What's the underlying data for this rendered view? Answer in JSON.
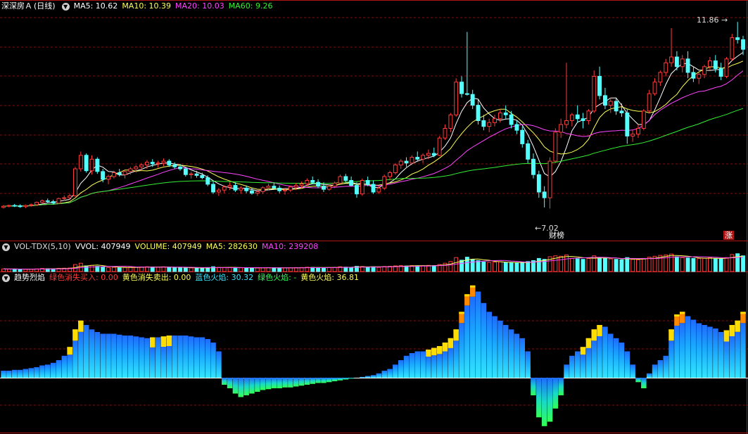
{
  "colors": {
    "up": "#ff3b3b",
    "down": "#54ffff",
    "ma5": "#ffffff",
    "ma10": "#ffff55",
    "ma20": "#ff44ff",
    "ma60": "#33ee33",
    "grid": "#7a1010",
    "border": "#b01515",
    "blue": "#1f6bff",
    "cyan": "#33e6ff",
    "green": "#33ff55",
    "yellow": "#ffdd00",
    "orange": "#ff8800",
    "red": "#ff2200"
  },
  "main_header": {
    "stock_name": "深深房Ａ",
    "period": "(日线)",
    "ma5": "MA5: 10.62",
    "ma10": "MA10: 10.39",
    "ma20": "MA20: 10.03",
    "ma60": "MA60: 9.26"
  },
  "volume_header": {
    "indicator": "VOL-TDX(5,10)",
    "vvol": "VVOL: 407949",
    "volume": "VOLUME: 407949",
    "ma5": "MA5: 282630",
    "ma10": "MA10: 239208"
  },
  "flame_header": {
    "indicator": "趋势烈焰",
    "green_buy": "绿色消失买入: 0.00",
    "yellow_sell": "黄色消失卖出: 0.00",
    "blue_flame": "蓝色火焰: 30.32",
    "green_flame": "绿色火焰: -",
    "yellow_flame": "黄色火焰: 36.81"
  },
  "annotations": {
    "high_price": "11.86",
    "low_price": "7.02",
    "report_tag": "财",
    "report_tag2": "榜",
    "rise_tag": "涨"
  },
  "chart_data": {
    "type": "candlestick",
    "price_range": [
      6.5,
      12.1
    ],
    "ohlc": [
      [
        7.05,
        7.11,
        7.02,
        7.08
      ],
      [
        7.08,
        7.12,
        7.05,
        7.1
      ],
      [
        7.1,
        7.14,
        7.06,
        7.09
      ],
      [
        7.09,
        7.13,
        7.04,
        7.07
      ],
      [
        7.07,
        7.12,
        7.03,
        7.1
      ],
      [
        7.1,
        7.15,
        7.07,
        7.12
      ],
      [
        7.12,
        7.2,
        7.09,
        7.18
      ],
      [
        7.18,
        7.26,
        7.14,
        7.22
      ],
      [
        7.22,
        7.28,
        7.16,
        7.2
      ],
      [
        7.2,
        7.25,
        7.12,
        7.16
      ],
      [
        7.16,
        7.3,
        7.14,
        7.28
      ],
      [
        7.28,
        7.36,
        7.22,
        7.3
      ],
      [
        7.3,
        7.4,
        7.25,
        7.35
      ],
      [
        7.35,
        8.1,
        7.33,
        8.05
      ],
      [
        8.05,
        8.5,
        7.98,
        8.4
      ],
      [
        8.4,
        8.45,
        7.95,
        8.0
      ],
      [
        8.0,
        8.4,
        7.9,
        8.3
      ],
      [
        8.3,
        8.35,
        7.92,
        7.98
      ],
      [
        7.98,
        8.05,
        7.7,
        7.78
      ],
      [
        7.78,
        7.9,
        7.65,
        7.85
      ],
      [
        7.85,
        8.0,
        7.8,
        7.95
      ],
      [
        7.95,
        8.05,
        7.85,
        7.9
      ],
      [
        7.9,
        8.0,
        7.8,
        7.98
      ],
      [
        7.98,
        8.1,
        7.9,
        8.05
      ],
      [
        8.05,
        8.15,
        7.95,
        8.1
      ],
      [
        8.1,
        8.2,
        8.0,
        8.15
      ],
      [
        8.15,
        8.28,
        8.05,
        8.22
      ],
      [
        8.22,
        8.3,
        8.1,
        8.18
      ],
      [
        8.18,
        8.26,
        8.08,
        8.2
      ],
      [
        8.2,
        8.32,
        8.12,
        8.25
      ],
      [
        8.25,
        8.3,
        8.1,
        8.15
      ],
      [
        8.15,
        8.22,
        8.05,
        8.1
      ],
      [
        8.1,
        8.18,
        8.0,
        8.05
      ],
      [
        8.05,
        8.1,
        7.85,
        7.9
      ],
      [
        7.9,
        7.98,
        7.8,
        7.92
      ],
      [
        7.92,
        8.0,
        7.82,
        7.88
      ],
      [
        7.88,
        7.95,
        7.78,
        7.82
      ],
      [
        7.82,
        7.88,
        7.6,
        7.65
      ],
      [
        7.65,
        7.75,
        7.4,
        7.45
      ],
      [
        7.45,
        7.55,
        7.35,
        7.5
      ],
      [
        7.5,
        7.62,
        7.42,
        7.58
      ],
      [
        7.58,
        7.7,
        7.5,
        7.62
      ],
      [
        7.62,
        7.7,
        7.45,
        7.5
      ],
      [
        7.5,
        7.6,
        7.4,
        7.55
      ],
      [
        7.55,
        7.62,
        7.42,
        7.48
      ],
      [
        7.48,
        7.55,
        7.38,
        7.42
      ],
      [
        7.42,
        7.52,
        7.35,
        7.46
      ],
      [
        7.46,
        7.6,
        7.4,
        7.56
      ],
      [
        7.56,
        7.66,
        7.5,
        7.6
      ],
      [
        7.6,
        7.7,
        7.52,
        7.55
      ],
      [
        7.55,
        7.62,
        7.42,
        7.48
      ],
      [
        7.48,
        7.56,
        7.38,
        7.5
      ],
      [
        7.5,
        7.62,
        7.45,
        7.58
      ],
      [
        7.58,
        7.68,
        7.5,
        7.62
      ],
      [
        7.62,
        7.72,
        7.55,
        7.66
      ],
      [
        7.66,
        7.8,
        7.6,
        7.75
      ],
      [
        7.75,
        7.85,
        7.65,
        7.7
      ],
      [
        7.7,
        7.78,
        7.55,
        7.6
      ],
      [
        7.6,
        7.7,
        7.45,
        7.52
      ],
      [
        7.52,
        7.65,
        7.48,
        7.6
      ],
      [
        7.6,
        7.72,
        7.55,
        7.68
      ],
      [
        7.68,
        7.9,
        7.65,
        7.85
      ],
      [
        7.85,
        7.92,
        7.7,
        7.75
      ],
      [
        7.75,
        7.85,
        7.6,
        7.62
      ],
      [
        7.62,
        7.7,
        7.3,
        7.4
      ],
      [
        7.4,
        7.8,
        7.35,
        7.75
      ],
      [
        7.75,
        7.85,
        7.6,
        7.65
      ],
      [
        7.65,
        7.75,
        7.4,
        7.45
      ],
      [
        7.45,
        7.6,
        7.4,
        7.55
      ],
      [
        7.55,
        7.9,
        7.5,
        7.85
      ],
      [
        7.85,
        8.0,
        7.75,
        7.95
      ],
      [
        7.95,
        8.2,
        7.9,
        8.15
      ],
      [
        8.15,
        8.3,
        8.05,
        8.25
      ],
      [
        8.25,
        8.35,
        8.1,
        8.2
      ],
      [
        8.2,
        8.4,
        8.15,
        8.35
      ],
      [
        8.35,
        8.5,
        8.25,
        8.3
      ],
      [
        8.3,
        8.45,
        8.2,
        8.4
      ],
      [
        8.4,
        8.55,
        8.3,
        8.45
      ],
      [
        8.45,
        8.6,
        8.35,
        8.4
      ],
      [
        8.4,
        8.9,
        8.38,
        8.85
      ],
      [
        8.85,
        9.2,
        8.8,
        9.1
      ],
      [
        9.1,
        9.5,
        9.0,
        9.45
      ],
      [
        9.45,
        10.4,
        9.4,
        10.3
      ],
      [
        10.3,
        10.45,
        9.9,
        10.0
      ],
      [
        10.0,
        11.6,
        9.95,
        9.98
      ],
      [
        9.98,
        10.1,
        9.6,
        9.7
      ],
      [
        9.7,
        9.85,
        9.2,
        9.3
      ],
      [
        9.3,
        9.45,
        9.05,
        9.15
      ],
      [
        9.15,
        9.35,
        9.0,
        9.25
      ],
      [
        9.25,
        9.45,
        9.15,
        9.35
      ],
      [
        9.35,
        9.6,
        9.25,
        9.5
      ],
      [
        9.5,
        9.7,
        9.35,
        9.45
      ],
      [
        9.45,
        9.55,
        9.1,
        9.2
      ],
      [
        9.2,
        9.3,
        8.95,
        9.05
      ],
      [
        9.05,
        9.15,
        8.6,
        8.7
      ],
      [
        8.7,
        8.8,
        8.2,
        8.3
      ],
      [
        8.3,
        8.45,
        7.8,
        7.9
      ],
      [
        7.9,
        8.0,
        7.3,
        7.45
      ],
      [
        7.45,
        7.6,
        7.05,
        7.3
      ],
      [
        7.3,
        8.35,
        7.02,
        8.25
      ],
      [
        8.25,
        9.1,
        8.2,
        9.0
      ],
      [
        9.0,
        9.35,
        8.85,
        9.2
      ],
      [
        9.2,
        10.8,
        9.1,
        9.3
      ],
      [
        9.3,
        9.5,
        9.15,
        9.45
      ],
      [
        9.45,
        9.7,
        9.25,
        9.35
      ],
      [
        9.35,
        9.5,
        9.1,
        9.3
      ],
      [
        9.3,
        9.6,
        9.2,
        9.55
      ],
      [
        9.55,
        10.6,
        9.5,
        10.45
      ],
      [
        10.45,
        10.7,
        9.85,
        9.95
      ],
      [
        9.95,
        10.15,
        9.6,
        9.7
      ],
      [
        9.7,
        9.9,
        9.5,
        9.8
      ],
      [
        9.8,
        9.9,
        9.45,
        9.55
      ],
      [
        9.55,
        9.75,
        9.4,
        9.5
      ],
      [
        9.5,
        9.6,
        8.7,
        8.9
      ],
      [
        8.9,
        9.05,
        8.75,
        8.95
      ],
      [
        8.95,
        9.2,
        8.85,
        9.1
      ],
      [
        9.1,
        9.6,
        9.05,
        9.55
      ],
      [
        9.55,
        10.1,
        9.5,
        10.0
      ],
      [
        10.0,
        10.4,
        9.95,
        10.3
      ],
      [
        10.3,
        10.6,
        10.2,
        10.55
      ],
      [
        10.55,
        10.9,
        10.45,
        10.8
      ],
      [
        10.8,
        11.7,
        10.7,
        10.95
      ],
      [
        10.95,
        11.1,
        10.6,
        10.7
      ],
      [
        10.7,
        11.0,
        10.55,
        10.9
      ],
      [
        10.9,
        11.1,
        10.4,
        10.55
      ],
      [
        10.55,
        10.7,
        10.3,
        10.4
      ],
      [
        10.4,
        10.55,
        10.25,
        10.5
      ],
      [
        10.5,
        10.75,
        10.4,
        10.7
      ],
      [
        10.7,
        10.95,
        10.6,
        10.85
      ],
      [
        10.85,
        11.0,
        10.55,
        10.65
      ],
      [
        10.65,
        10.8,
        10.35,
        10.45
      ],
      [
        10.45,
        10.95,
        10.4,
        10.9
      ],
      [
        10.9,
        11.55,
        10.85,
        11.45
      ],
      [
        11.45,
        11.86,
        11.3,
        11.4
      ],
      [
        11.4,
        11.5,
        11.0,
        11.15
      ]
    ],
    "volume_max": 420000,
    "volumes": [
      60000,
      55000,
      58000,
      52000,
      50000,
      54000,
      62000,
      70000,
      65000,
      60000,
      72000,
      76000,
      80000,
      160000,
      190000,
      130000,
      140000,
      120000,
      100000,
      90000,
      95000,
      88000,
      92000,
      98000,
      100000,
      105000,
      110000,
      102000,
      100000,
      108000,
      96000,
      90000,
      88000,
      85000,
      82000,
      80000,
      78000,
      90000,
      110000,
      95000,
      90000,
      92000,
      88000,
      86000,
      84000,
      82000,
      80000,
      86000,
      90000,
      88000,
      84000,
      82000,
      86000,
      90000,
      92000,
      98000,
      94000,
      90000,
      88000,
      92000,
      95000,
      110000,
      100000,
      96000,
      120000,
      115000,
      102000,
      110000,
      96000,
      115000,
      120000,
      130000,
      135000,
      128000,
      136000,
      132000,
      134000,
      140000,
      136000,
      160000,
      190000,
      230000,
      320000,
      260000,
      330000,
      280000,
      250000,
      220000,
      210000,
      215000,
      225000,
      210000,
      200000,
      195000,
      210000,
      230000,
      250000,
      300000,
      280000,
      340000,
      360000,
      350000,
      380000,
      300000,
      290000,
      280000,
      300000,
      360000,
      320000,
      300000,
      290000,
      280000,
      270000,
      320000,
      280000,
      270000,
      300000,
      330000,
      350000,
      370000,
      380000,
      400000,
      340000,
      320000,
      310000,
      300000,
      295000,
      305000,
      315000,
      300000,
      290000,
      320000,
      390000,
      407949,
      360000
    ],
    "flame": [
      8,
      8,
      9,
      9,
      10,
      11,
      12,
      14,
      15,
      17,
      20,
      25,
      35,
      55,
      65,
      60,
      55,
      52,
      50,
      50,
      50,
      49,
      48,
      48,
      47,
      46,
      45,
      46,
      46,
      47,
      48,
      48,
      48,
      48,
      47,
      46,
      46,
      44,
      40,
      30,
      -8,
      -12,
      -18,
      -22,
      -20,
      -18,
      -16,
      -14,
      -13,
      -12,
      -12,
      -11,
      -11,
      -10,
      -9,
      -8,
      -7,
      -6,
      -6,
      -5,
      -4,
      -3,
      -2,
      -1,
      0,
      1,
      2,
      3,
      5,
      8,
      10,
      15,
      20,
      25,
      28,
      30,
      30,
      32,
      34,
      36,
      40,
      45,
      55,
      75,
      95,
      105,
      98,
      85,
      75,
      70,
      65,
      60,
      55,
      50,
      45,
      30,
      -20,
      -45,
      -55,
      -50,
      -35,
      -20,
      15,
      25,
      30,
      35,
      45,
      55,
      60,
      58,
      50,
      45,
      40,
      30,
      15,
      -5,
      -12,
      5,
      15,
      20,
      25,
      55,
      72,
      75,
      70,
      66,
      62,
      60,
      58,
      56,
      52,
      54,
      60,
      65,
      75
    ]
  }
}
